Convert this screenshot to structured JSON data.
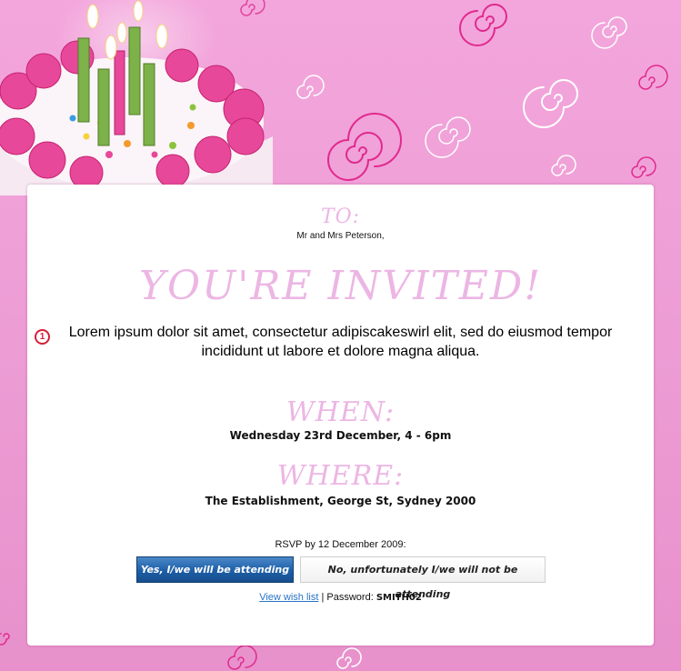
{
  "invitation": {
    "to_label": "TO:",
    "to_name": "Mr and Mrs Peterson,",
    "headline": "YOU'RE INVITED!",
    "marker_number": "1",
    "body_text": "Lorem ipsum dolor sit amet, consectetur adipiscakeswirl elit, sed do eiusmod tempor incididunt ut labore et dolore magna aliqua.",
    "when_label": "WHEN:",
    "when_value": "Wednesday 23rd December, 4 - 6pm",
    "where_label": "WHERE:",
    "where_value": "The Establishment, George St, Sydney 2000",
    "rsvp_text": "RSVP by 12 December 2009:",
    "yes_button": "Yes, I/we will be attending",
    "no_button": "No, unfortunately I/we will not be attending",
    "wishlist_link": "View wish list",
    "separator": " | ",
    "password_label": "Password: ",
    "password_value": "SMITH02"
  },
  "colors": {
    "background": "#f3a6dc",
    "accent_pink": "#ecb6e4",
    "button_blue": "#1d5ea6",
    "link_blue": "#2a74c6",
    "marker_red": "#d71f37"
  },
  "icons": [
    "birthday-cake-image",
    "swirl-decoration",
    "numbered-marker-icon"
  ]
}
